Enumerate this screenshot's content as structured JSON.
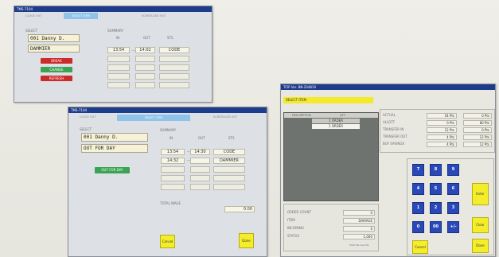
{
  "win1": {
    "title": "TMS-7104",
    "tabs": [
      "CLOCK OUT",
      "SELECT ITEM",
      "SCHEDULED OUT"
    ],
    "select_label": "SELECT",
    "summary_label": "SUMMARY",
    "col_in": "IN",
    "col_out": "OUT",
    "col_sts": "STS",
    "employee": "001 Danny D.",
    "status": "DAMMIER",
    "time_in": "13:54",
    "time_out": "14:02",
    "time_sts": "CODE",
    "btn_red1": "BREAK",
    "btn_green": "CHANGE",
    "btn_red2": "REFRESH"
  },
  "win2": {
    "title": "TMS-7104",
    "tabs": [
      "CLOCK OUT",
      "SELECT ITEM",
      "SCHEDULED OUT"
    ],
    "select_label": "SELECT",
    "summary_label": "SUMMARY",
    "col_in": "IN",
    "col_out": "OUT",
    "col_sts": "STS",
    "employee": "001 Danny D.",
    "reason": "OUT FOR DAY",
    "row1": [
      "13:54",
      "14:30",
      "CODE"
    ],
    "row2": [
      "14:32",
      "",
      "DAMMIER"
    ],
    "green_btn": "OUT FOR DAY",
    "total_label": "TOTAL WAGE",
    "total_value": "0.00",
    "cancel": "Cancel",
    "done": "Done"
  },
  "win3": {
    "title": "TCIP Ver. BN-204810",
    "select_item": "SELECT ITEM",
    "list_header": [
      "DESCRIPTION",
      "QTY"
    ],
    "list_rows": [
      "1 ORDER",
      "1 ORDER"
    ],
    "stats": [
      {
        "label": "ACTUAL",
        "v1": "54 Pts",
        "v2": "0 Pts"
      },
      {
        "label": "ALLOTT",
        "v1": "0 Pts",
        "v2": "80 Pts"
      },
      {
        "label": "TRANSFER IN",
        "v1": "12 Pts",
        "v2": "0 Pts"
      },
      {
        "label": "TRANSFER OUT",
        "v1": "4 Pts",
        "v2": "12 Pts"
      },
      {
        "label": "BUY SAVINGS",
        "v1": "4 Pts",
        "v2": "12 Pts"
      }
    ],
    "counters": [
      {
        "label": "ORDER COUNT",
        "value": "0"
      },
      {
        "label": "ITEM",
        "value": "DAMAGE"
      },
      {
        "label": "INCOMING",
        "value": "0"
      },
      {
        "label": "STATUS",
        "value": "1,000"
      }
    ],
    "footer_note": "Total Pts Ave Pts",
    "keys": [
      "7",
      "8",
      "9",
      "4",
      "5",
      "6",
      "1",
      "2",
      "3",
      "0",
      "00",
      "+/-"
    ],
    "enter": "Enter",
    "clear": "Clear",
    "cancel": "Cancel",
    "done": "Done"
  }
}
